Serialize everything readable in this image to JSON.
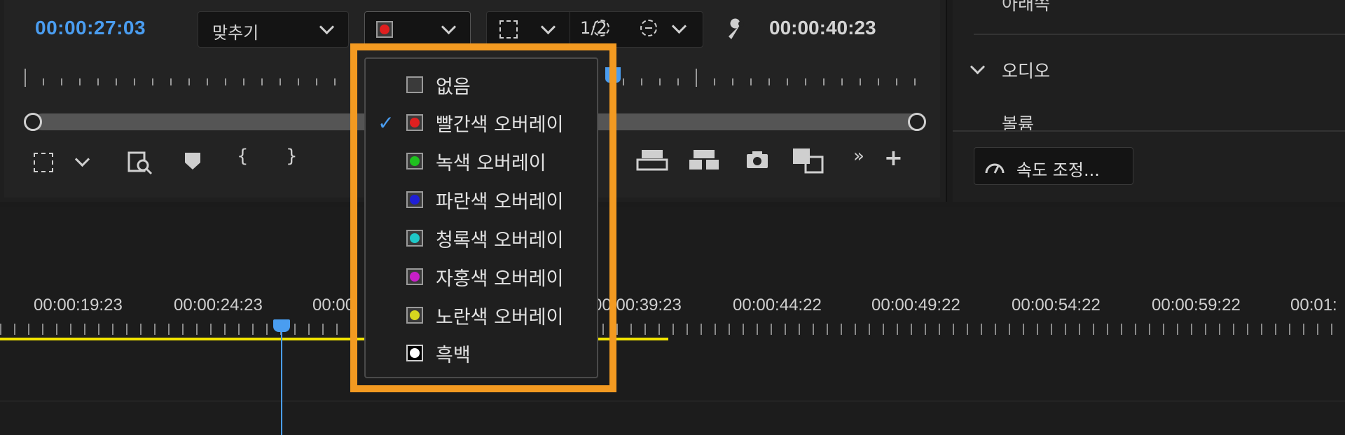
{
  "monitor": {
    "current_timecode": "00:00:27:03",
    "duration_timecode": "00:00:40:23",
    "fit_dropdown": "맞추기",
    "resolution": "1/2"
  },
  "effects_panel": {
    "partial_top_label": "아래쪽",
    "audio_section": "오디오",
    "volume_label": "볼륨",
    "speed_button": "속도 조정..."
  },
  "timeline": {
    "ruler_labels": [
      "00:00:19:23",
      "00:00:24:23",
      "00:00",
      "00:00:39:23",
      "00:00:44:22",
      "00:00:49:22",
      "00:00:54:22",
      "00:00:59:22",
      "00:01:"
    ]
  },
  "overlay_menu": {
    "items": [
      {
        "label": "없음",
        "color": "#3a3a3a",
        "selected": false
      },
      {
        "label": "빨간색 오버레이",
        "color": "#e01f1f",
        "selected": true
      },
      {
        "label": "녹색 오버레이",
        "color": "#1fc11f",
        "selected": false
      },
      {
        "label": "파란색 오버레이",
        "color": "#1f1fd6",
        "selected": false
      },
      {
        "label": "청록색 오버레이",
        "color": "#1fc8c8",
        "selected": false
      },
      {
        "label": "자홍색 오버레이",
        "color": "#c81fc8",
        "selected": false
      },
      {
        "label": "노란색 오버레이",
        "color": "#d6d61f",
        "selected": false
      },
      {
        "label": "흑백",
        "color": "#ffffff",
        "selected": false
      }
    ],
    "check_glyph": "✓"
  },
  "colors": {
    "accent_blue": "#4a9df0",
    "highlight_orange": "#f39a21",
    "work_area_yellow": "#f2e400"
  }
}
